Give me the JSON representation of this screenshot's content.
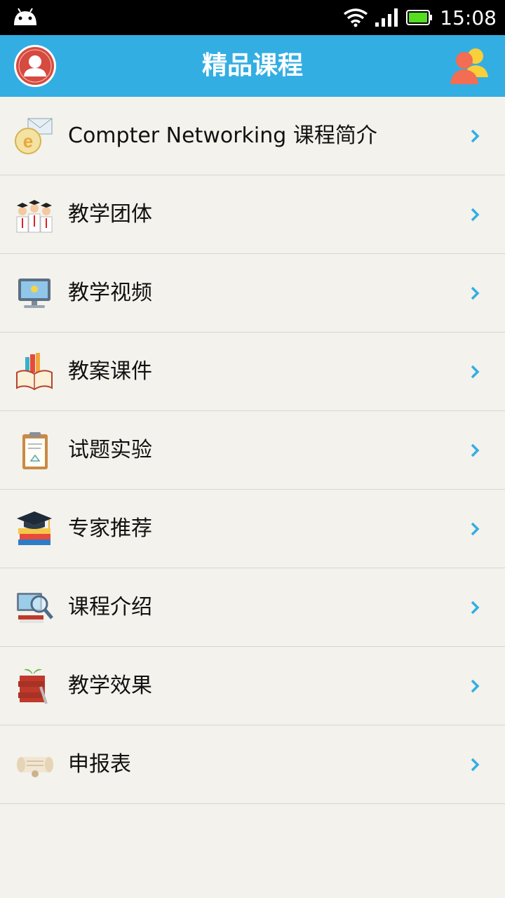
{
  "status_bar": {
    "time": "15:08"
  },
  "app_bar": {
    "title": "精品课程"
  },
  "menu": {
    "items": [
      {
        "label": "Compter Networking 课程简介",
        "icon": "ie-mail-icon"
      },
      {
        "label": "教学团体",
        "icon": "graduates-icon"
      },
      {
        "label": "教学视频",
        "icon": "monitor-icon"
      },
      {
        "label": "教案课件",
        "icon": "open-book-icon"
      },
      {
        "label": "试题实验",
        "icon": "clipboard-icon"
      },
      {
        "label": "专家推荐",
        "icon": "grad-cap-books-icon"
      },
      {
        "label": "课程介绍",
        "icon": "magnifier-computer-icon"
      },
      {
        "label": "教学效果",
        "icon": "book-stack-icon"
      },
      {
        "label": "申报表",
        "icon": "scroll-icon"
      }
    ]
  },
  "colors": {
    "app_bar": "#33aee3",
    "background": "#f3f2ec",
    "chevron": "#33aee3",
    "status_bar": "#000000"
  }
}
